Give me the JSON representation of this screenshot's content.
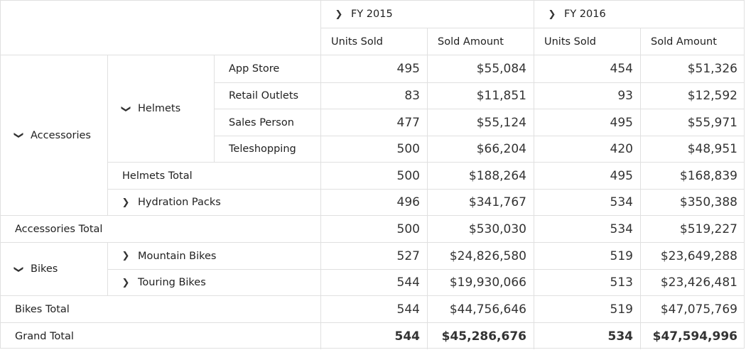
{
  "column_headers": {
    "years": [
      {
        "label": "FY 2015"
      },
      {
        "label": "FY 2016"
      }
    ],
    "measures": [
      "Units Sold",
      "Sold Amount",
      "Units Sold",
      "Sold Amount"
    ]
  },
  "row_headers": {
    "accessories": "Accessories",
    "helmets": "Helmets",
    "app_store": "App Store",
    "retail_outlets": "Retail Outlets",
    "sales_person": "Sales Person",
    "teleshopping": "Teleshopping",
    "helmets_total": "Helmets Total",
    "hydration_packs": "Hydration Packs",
    "accessories_total": "Accessories Total",
    "bikes": "Bikes",
    "mountain_bikes": "Mountain Bikes",
    "touring_bikes": "Touring Bikes",
    "bikes_total": "Bikes Total",
    "grand_total": "Grand Total"
  },
  "rows": [
    [
      "495",
      "$55,084",
      "454",
      "$51,326"
    ],
    [
      "83",
      "$11,851",
      "93",
      "$12,592"
    ],
    [
      "477",
      "$55,124",
      "495",
      "$55,971"
    ],
    [
      "500",
      "$66,204",
      "420",
      "$48,951"
    ],
    [
      "500",
      "$188,264",
      "495",
      "$168,839"
    ],
    [
      "496",
      "$341,767",
      "534",
      "$350,388"
    ],
    [
      "500",
      "$530,030",
      "534",
      "$519,227"
    ],
    [
      "527",
      "$24,826,580",
      "519",
      "$23,649,288"
    ],
    [
      "544",
      "$19,930,066",
      "513",
      "$23,426,481"
    ],
    [
      "544",
      "$44,756,646",
      "519",
      "$47,075,769"
    ],
    [
      "544",
      "$45,286,676",
      "534",
      "$47,594,996"
    ]
  ]
}
